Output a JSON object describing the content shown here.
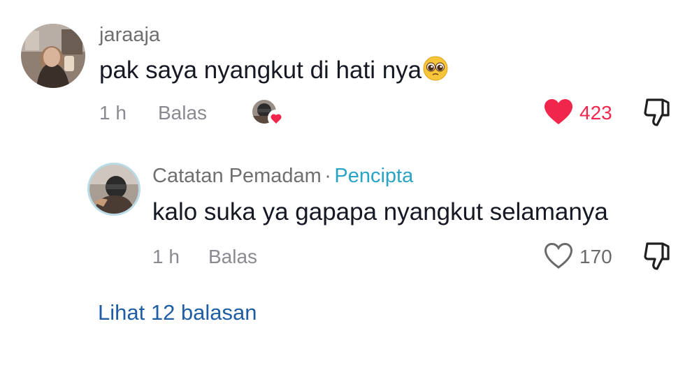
{
  "colors": {
    "liked": "#f0264d",
    "creator_badge": "#2aa4c4",
    "view_replies": "#1f5ea3",
    "muted": "#8a8b91"
  },
  "comment": {
    "username": "jaraaja",
    "text": "pak saya nyangkut di hati nya",
    "emoji": "🥺",
    "time": "1 h",
    "reply_label": "Balas",
    "like_count": "423",
    "liked": true,
    "like_icon": "heart-filled-icon",
    "dislike_icon": "thumbs-down-icon",
    "creator_liked_badge": "creator-liked-heart-badge"
  },
  "reply": {
    "username": "Catatan Pemadam",
    "separator": "·",
    "badge": "Pencipta",
    "text": "kalo suka ya gapapa nyangkut selamanya",
    "time": "1 h",
    "reply_label": "Balas",
    "like_count": "170",
    "liked": false,
    "like_icon": "heart-outline-icon",
    "dislike_icon": "thumbs-down-icon"
  },
  "view_replies_label": "Lihat 12 balasan"
}
